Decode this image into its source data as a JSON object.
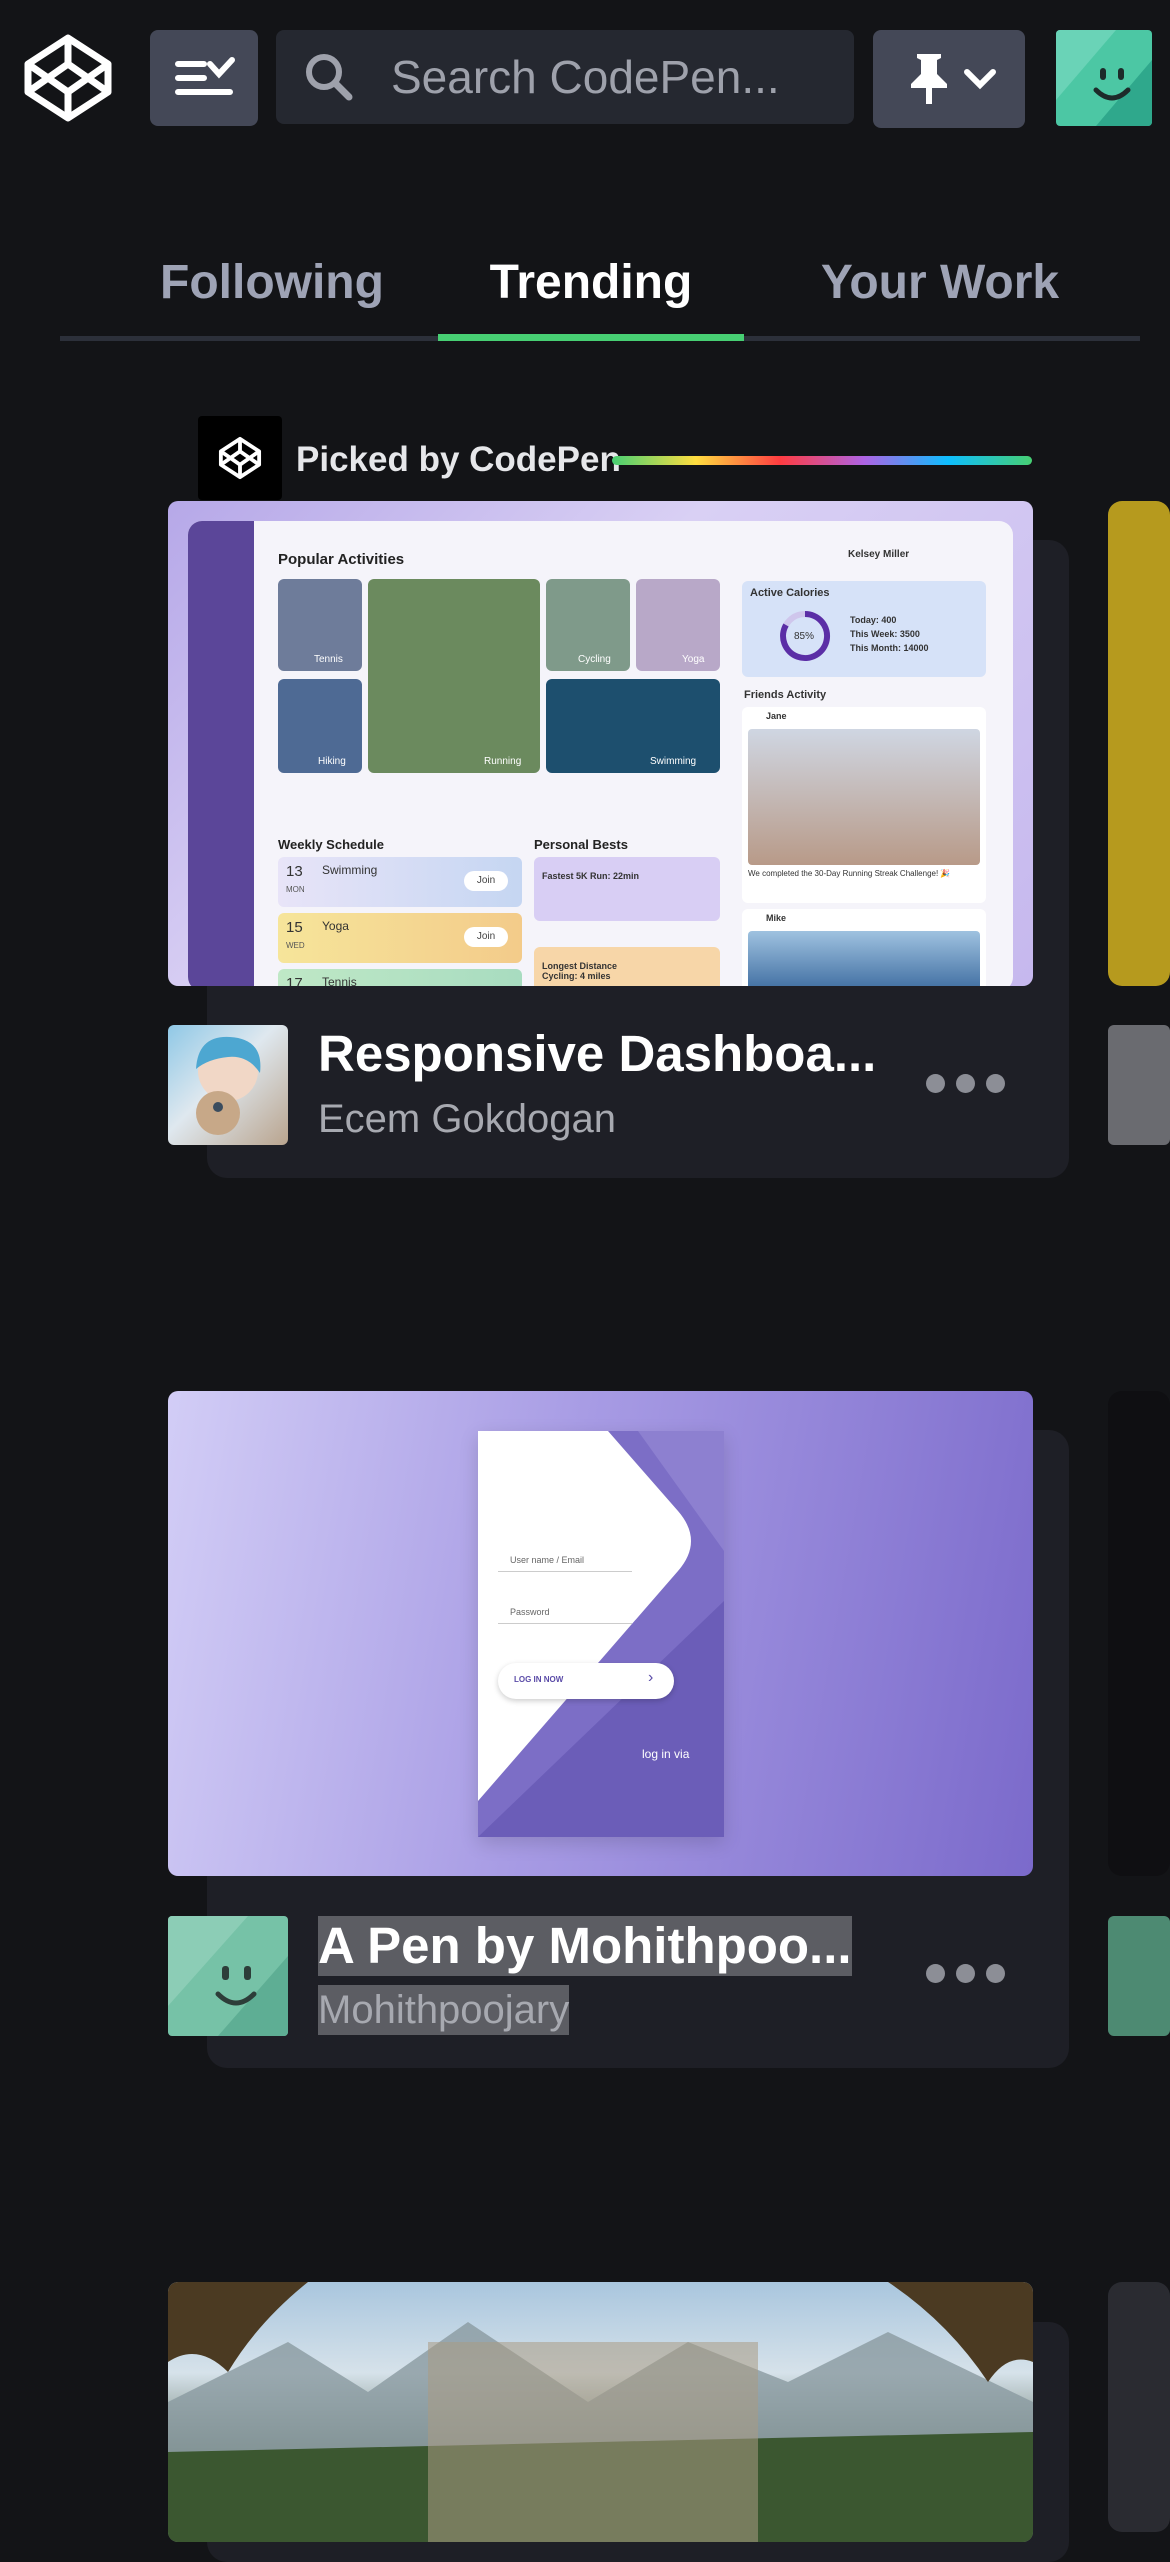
{
  "header": {
    "search_placeholder": "Search CodePen..."
  },
  "tabs": [
    {
      "label": "Following"
    },
    {
      "label": "Trending"
    },
    {
      "label": "Your Work"
    }
  ],
  "picked": {
    "label": "Picked by CodePen"
  },
  "cards": [
    {
      "title": "Responsive Dashboa...",
      "author": "Ecem Gokdogan",
      "preview": {
        "heading": "Popular Activities",
        "user": "Kelsey Miller",
        "activities": [
          "Tennis",
          "Running",
          "Cycling",
          "Yoga",
          "Hiking",
          "Swimming"
        ],
        "calories_title": "Active Calories",
        "calories_pct": "85%",
        "today": "Today: 400",
        "week": "This Week: 3500",
        "month": "This Month: 14000",
        "friends_title": "Friends Activity",
        "friend1": "Jane",
        "friend1_msg": "We completed the 30-Day Running Streak Challenge! 🎉",
        "friend2": "Mike",
        "schedule_title": "Weekly Schedule",
        "sched": [
          {
            "day": "13",
            "dow": "MON",
            "name": "Swimming",
            "btn": "Join"
          },
          {
            "day": "15",
            "dow": "WED",
            "name": "Yoga",
            "btn": "Join"
          },
          {
            "day": "17",
            "dow": "",
            "name": "Tennis",
            "btn": ""
          }
        ],
        "bests_title": "Personal Bests",
        "best1": "Fastest 5K Run: 22min",
        "best2": "Longest Distance Cycling: 4 miles"
      }
    },
    {
      "title": "A Pen by Mohithpoo...",
      "author": "Mohithpoojary",
      "preview": {
        "user_label": "User name / Email",
        "pass_label": "Password",
        "login_btn": "LOG IN NOW",
        "login_via": "log in via"
      }
    },
    {
      "title": "",
      "author": ""
    }
  ]
}
